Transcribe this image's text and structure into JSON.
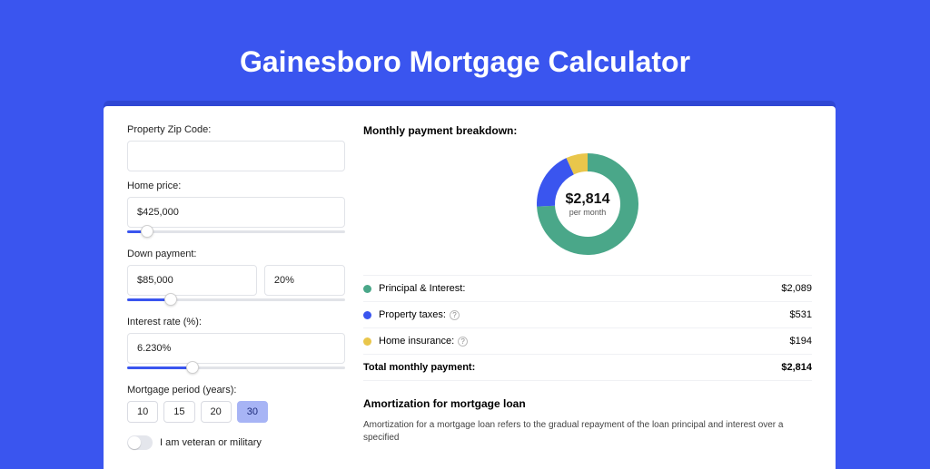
{
  "title": "Gainesboro Mortgage Calculator",
  "colors": {
    "principal": "#4aa789",
    "taxes": "#3a55ef",
    "insurance": "#e9c64b"
  },
  "form": {
    "zip": {
      "label": "Property Zip Code:",
      "value": ""
    },
    "home_price": {
      "label": "Home price:",
      "value": "$425,000",
      "slider_pct": 9
    },
    "down_payment": {
      "label": "Down payment:",
      "value": "$85,000",
      "pct": "20%",
      "slider_pct": 20
    },
    "interest_rate": {
      "label": "Interest rate (%):",
      "value": "6.230%",
      "slider_pct": 30
    },
    "period": {
      "label": "Mortgage period (years):",
      "options": [
        "10",
        "15",
        "20",
        "30"
      ],
      "selected": "30"
    },
    "veteran": {
      "label": "I am veteran or military",
      "checked": false
    }
  },
  "breakdown": {
    "title": "Monthly payment breakdown:",
    "center_value": "$2,814",
    "center_sub": "per month",
    "items": [
      {
        "key": "principal",
        "label": "Principal & Interest:",
        "value": "$2,089",
        "info": false
      },
      {
        "key": "taxes",
        "label": "Property taxes:",
        "value": "$531",
        "info": true
      },
      {
        "key": "insurance",
        "label": "Home insurance:",
        "value": "$194",
        "info": true
      }
    ],
    "total_label": "Total monthly payment:",
    "total_value": "$2,814"
  },
  "chart_data": {
    "type": "pie",
    "title": "Monthly payment breakdown:",
    "series": [
      {
        "name": "Principal & Interest",
        "value": 2089,
        "color": "#4aa789"
      },
      {
        "name": "Property taxes",
        "value": 531,
        "color": "#3a55ef"
      },
      {
        "name": "Home insurance",
        "value": 194,
        "color": "#e9c64b"
      }
    ],
    "total": 2814,
    "inner_radius_pct": 62
  },
  "amortization": {
    "title": "Amortization for mortgage loan",
    "text": "Amortization for a mortgage loan refers to the gradual repayment of the loan principal and interest over a specified"
  }
}
